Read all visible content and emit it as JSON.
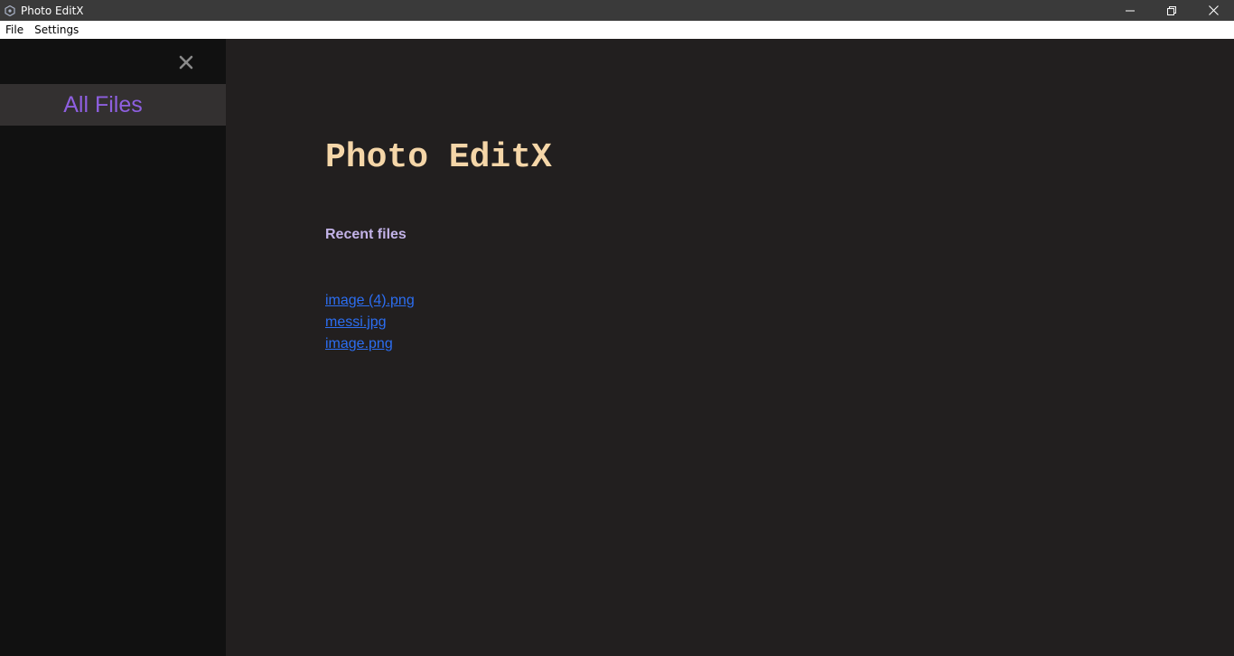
{
  "window": {
    "title": "Photo EditX"
  },
  "menubar": {
    "items": [
      {
        "label": "File"
      },
      {
        "label": "Settings"
      }
    ]
  },
  "sidebar": {
    "close_icon": "close-icon",
    "items": [
      {
        "label": "All Files"
      }
    ]
  },
  "main": {
    "heading": "Photo EditX",
    "recent_label": "Recent files",
    "recent_files": [
      {
        "name": "image (4).png"
      },
      {
        "name": "messi.jpg"
      },
      {
        "name": "image.png"
      }
    ]
  },
  "colors": {
    "titlebar_bg": "#3a3a3a",
    "sidebar_bg": "#111111",
    "sidebar_item_bg": "#333030",
    "sidebar_item_text": "#8e5fe0",
    "main_bg": "#221f1f",
    "heading": "#f5d6a8",
    "recent_label": "#c3b3e8",
    "link": "#2c6ef2"
  }
}
